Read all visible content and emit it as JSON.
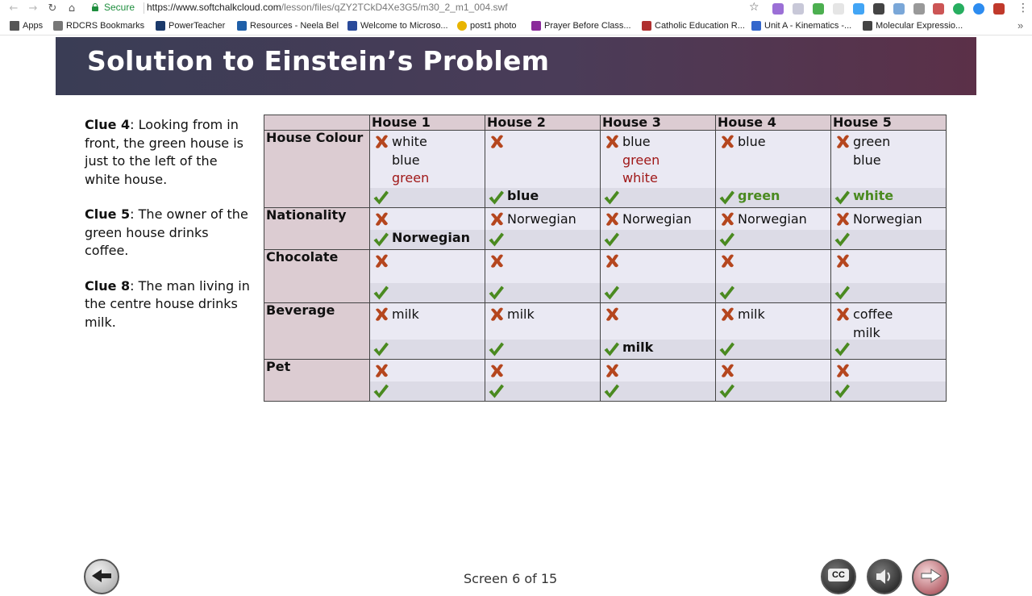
{
  "browser": {
    "secure_label": "Secure",
    "url_host": "https://www.softchalkcloud.com",
    "url_path": "/lesson/files/qZY2TCkD4Xe3G5/m30_2_m1_004.swf",
    "bookmarks": [
      {
        "label": "Apps",
        "icon": "apps-grid-icon",
        "color": "#555555"
      },
      {
        "label": "RDCRS Bookmarks",
        "icon": "folder-icon",
        "color": "#666666"
      },
      {
        "label": "PowerTeacher",
        "icon": "powerteacher-icon",
        "color": "#1b3a6b"
      },
      {
        "label": "Resources - Neela Bel",
        "icon": "nb-icon",
        "color": "#1f5fa8"
      },
      {
        "label": "Welcome to Microso...",
        "icon": "mountain-icon",
        "color": "#2a4a9a"
      },
      {
        "label": "post1 photo",
        "icon": "speech-bubble-icon",
        "color": "#e8b400"
      },
      {
        "label": "Prayer Before Class...",
        "icon": "cross-icon",
        "color": "#8a2a9a"
      },
      {
        "label": "Catholic Education R...",
        "icon": "star-cross-icon",
        "color": "#b03030"
      },
      {
        "label": "Unit A - Kinematics -...",
        "icon": "page-icon",
        "color": "#3366cc"
      },
      {
        "label": "Molecular Expressio...",
        "icon": "microscope-icon",
        "color": "#444444"
      }
    ]
  },
  "lesson": {
    "title": "Solution to Einstein’s Problem",
    "clues": [
      {
        "label": "Clue 4",
        "text": ": Looking from in front, the green house is just to the left of the white house."
      },
      {
        "label": "Clue 5",
        "text": ": The owner of the green house drinks coffee."
      },
      {
        "label": "Clue 8",
        "text": ": The man living in the centre house drinks milk."
      }
    ],
    "page_indicator": "Screen 6 of 15"
  },
  "table": {
    "houses": [
      "House 1",
      "House 2",
      "House 3",
      "House 4",
      "House 5"
    ],
    "rows": [
      {
        "label": "House Colour",
        "cells": [
          {
            "excluded": [
              "white",
              "blue",
              "green"
            ],
            "red_from": 2,
            "selected": ""
          },
          {
            "excluded": [],
            "red_from": -1,
            "selected": "blue"
          },
          {
            "excluded": [
              "blue",
              "green",
              "white"
            ],
            "red_from": 1,
            "selected": ""
          },
          {
            "excluded": [
              "blue"
            ],
            "red_from": -1,
            "selected": "green"
          },
          {
            "excluded": [
              "green",
              "blue"
            ],
            "red_from": -1,
            "selected": "white"
          }
        ]
      },
      {
        "label": "Nationality",
        "cells": [
          {
            "excluded": [],
            "selected": "Norwegian"
          },
          {
            "excluded": [
              "Norwegian"
            ],
            "selected": ""
          },
          {
            "excluded": [
              "Norwegian"
            ],
            "selected": ""
          },
          {
            "excluded": [
              "Norwegian"
            ],
            "selected": ""
          },
          {
            "excluded": [
              "Norwegian"
            ],
            "selected": ""
          }
        ]
      },
      {
        "label": "Chocolate",
        "cells": [
          {
            "excluded": [],
            "selected": ""
          },
          {
            "excluded": [],
            "selected": ""
          },
          {
            "excluded": [],
            "selected": ""
          },
          {
            "excluded": [],
            "selected": ""
          },
          {
            "excluded": [],
            "selected": ""
          }
        ]
      },
      {
        "label": "Beverage",
        "cells": [
          {
            "excluded": [
              "milk"
            ],
            "selected": ""
          },
          {
            "excluded": [
              "milk"
            ],
            "selected": ""
          },
          {
            "excluded": [],
            "selected": "milk"
          },
          {
            "excluded": [
              "milk"
            ],
            "selected": ""
          },
          {
            "excluded": [
              "coffee",
              "milk"
            ],
            "selected": ""
          }
        ]
      },
      {
        "label": "Pet",
        "cells": [
          {
            "excluded": [],
            "selected": ""
          },
          {
            "excluded": [],
            "selected": ""
          },
          {
            "excluded": [],
            "selected": ""
          },
          {
            "excluded": [],
            "selected": ""
          },
          {
            "excluded": [],
            "selected": ""
          }
        ]
      }
    ]
  },
  "colors": {
    "banner_start": "#3a3d55",
    "banner_end": "#5b3048",
    "header_bg": "#dcccd2",
    "cell_bg": "#eae9f3",
    "cross": "#b5461e",
    "check": "#4a8a20",
    "excluded_red_text": "#a01818"
  }
}
